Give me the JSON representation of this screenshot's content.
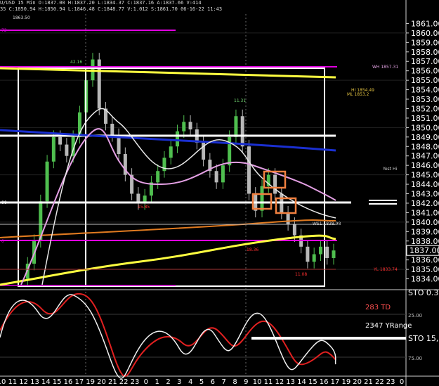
{
  "header": {
    "line1": "U/USD 15 Min O:1837.00 H:1837.20 L:1834.37 C:1837.16 A:1837.66 V:414",
    "line2": "35 C:1850.94 H:1850.94 L:1846.48 C:1848.77 V:1.012 S:1861.70 06-16-22 11:43"
  },
  "price_axis": {
    "ticks": [
      "1861.00",
      "1860.00",
      "1859.00",
      "1858.00",
      "1857.00",
      "1856.00",
      "1855.00",
      "1854.00",
      "1853.00",
      "1852.00",
      "1851.00",
      "1850.00",
      "1849.00",
      "1848.00",
      "1847.00",
      "1846.00",
      "1845.00",
      "1844.00",
      "1843.00",
      "1842.00",
      "1841.00",
      "1840.00",
      "1839.00",
      "1838.00",
      "1837.00",
      "1836.00",
      "1835.00",
      "1834.00"
    ],
    "current_price": "1837.00"
  },
  "time_axis": {
    "ticks": [
      "10",
      "11",
      "12",
      "13",
      "14",
      "15",
      "16",
      "17",
      "19",
      "20",
      "21",
      "22",
      "23",
      "0",
      "1",
      "2",
      "3",
      "4",
      "5",
      "6",
      "7",
      "8",
      "9",
      "10",
      "11",
      "12",
      "13",
      "14",
      "15",
      "16",
      "17",
      "19",
      "20",
      "21",
      "22",
      "23",
      "0"
    ]
  },
  "annotations": {
    "top_level": "1863.50",
    "high_label": "42.16",
    "peak_label": "11.31",
    "low_label_1": "15.85",
    "low_label_2": "18.36",
    "low_label_3": "11.08",
    "ws1_label": "WS1 1838.98",
    "yl_label": "YL 1833.74",
    "yest_hi": "Yest Hi",
    "pink_top_label": "WH 1857.31",
    "mid_label_a": "HI 1854.49",
    "mid_label_b": "ML 1853.2",
    "left_mark_1": "72",
    "left_mark_2": "00",
    "left_mark_3": "0"
  },
  "lower_panel": {
    "td_label": "283 TD",
    "yrange_label": "2347 YRange",
    "sto_label": "STO 15,",
    "sto_top": "STO 0.3",
    "level_25": "25.00",
    "level_75": "75.00"
  },
  "colors": {
    "background": "#000000",
    "yellow_line": "#ffff40",
    "blue_line": "#1a2fd0",
    "magenta": "#e000e0",
    "orange_line": "#e07a20",
    "pink_ma": "#e4a0e4",
    "white": "#ffffff",
    "candle_up": "#4fbf4f",
    "candle_down": "#b8b8b8",
    "box_orange": "#f08040",
    "red_label": "#ff3030",
    "sto_red": "#e02020"
  },
  "chart_data": {
    "type": "candlestick",
    "instrument": "XAU/USD",
    "timeframe": "15 Min",
    "ylim": [
      1833.0,
      1862.0
    ],
    "price_series_approx": [
      1834.0,
      1835.6,
      1838.0,
      1842.2,
      1846.4,
      1849.0,
      1848.2,
      1847.0,
      1849.0,
      1851.6,
      1855.0,
      1857.2,
      1852.0,
      1850.4,
      1849.2,
      1847.2,
      1845.0,
      1843.0,
      1842.0,
      1842.8,
      1844.2,
      1845.4,
      1846.8,
      1848.0,
      1849.6,
      1850.6,
      1849.8,
      1848.4,
      1846.6,
      1845.4,
      1844.2,
      1846.0,
      1849.0,
      1851.2,
      1848.0,
      1843.0,
      1841.2,
      1843.8,
      1845.0,
      1843.0,
      1841.0,
      1839.8,
      1838.6,
      1837.4,
      1835.8,
      1836.6,
      1837.4,
      1836.2,
      1837.0
    ],
    "horizontal_levels": [
      {
        "name": "yellow_descending_start",
        "value": 1857.2
      },
      {
        "name": "white_upper",
        "value": 1849.4
      },
      {
        "name": "white_lower",
        "value": 1841.8
      },
      {
        "name": "magenta_top",
        "value": 1863.5
      },
      {
        "name": "magenta_lower",
        "value": 1837.0
      },
      {
        "name": "ws1",
        "value": 1838.98
      },
      {
        "name": "yl",
        "value": 1833.74
      }
    ]
  }
}
